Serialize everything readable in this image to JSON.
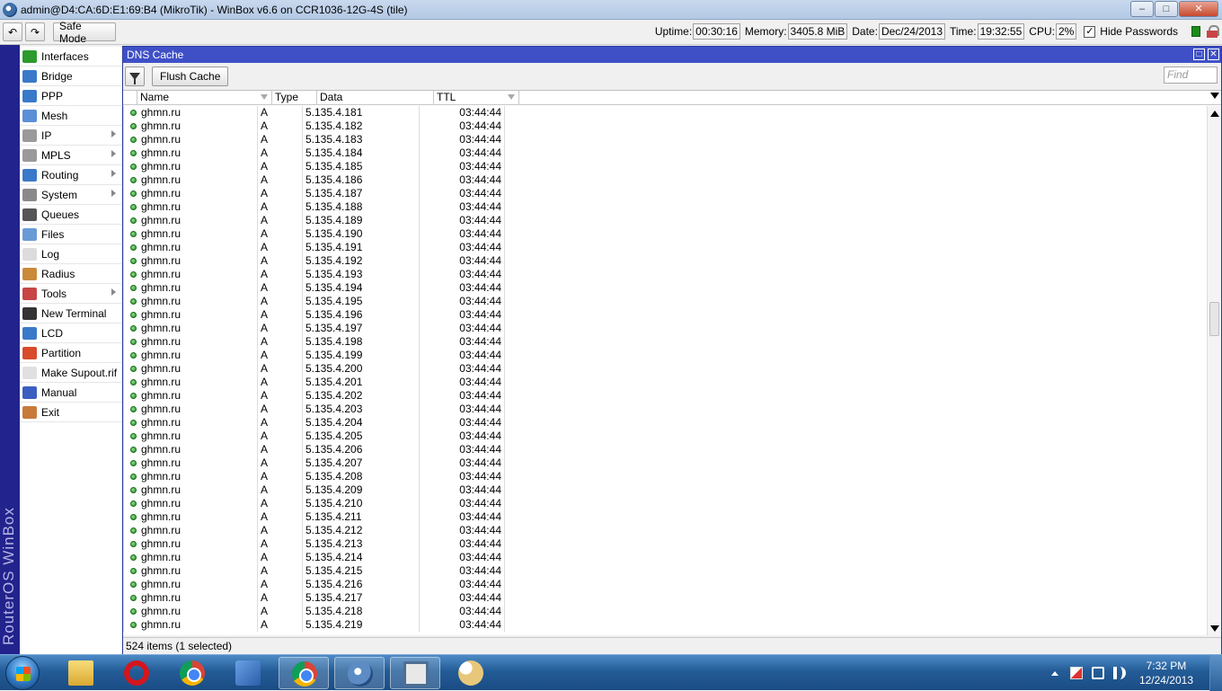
{
  "titlebar": {
    "title": "admin@D4:CA:6D:E1:69:B4 (MikroTik) - WinBox v6.6 on CCR1036-12G-4S (tile)"
  },
  "toolbar": {
    "undo_icon": "undo-icon",
    "redo_icon": "redo-icon",
    "safe_mode": "Safe Mode",
    "uptime_label": "Uptime:",
    "uptime": "00:30:16",
    "memory_label": "Memory:",
    "memory": "3405.8 MiB",
    "date_label": "Date:",
    "date": "Dec/24/2013",
    "time_label": "Time:",
    "time": "19:32:55",
    "cpu_label": "CPU:",
    "cpu": "2%",
    "hide_passwords": "Hide Passwords",
    "hide_passwords_checked": true
  },
  "brand": "RouterOS WinBox",
  "sidebar": {
    "items": [
      {
        "label": "Interfaces",
        "icon": "interfaces-icon",
        "color": "#2d9b2d",
        "submenu": false
      },
      {
        "label": "Bridge",
        "icon": "bridge-icon",
        "color": "#3a79c9",
        "submenu": false
      },
      {
        "label": "PPP",
        "icon": "ppp-icon",
        "color": "#3a79c9",
        "submenu": false
      },
      {
        "label": "Mesh",
        "icon": "mesh-icon",
        "color": "#5b8fd6",
        "submenu": false
      },
      {
        "label": "IP",
        "icon": "ip-icon",
        "color": "#9a9a9a",
        "submenu": true
      },
      {
        "label": "MPLS",
        "icon": "mpls-icon",
        "color": "#9a9a9a",
        "submenu": true
      },
      {
        "label": "Routing",
        "icon": "routing-icon",
        "color": "#3a79c9",
        "submenu": true
      },
      {
        "label": "System",
        "icon": "system-icon",
        "color": "#8a8a8a",
        "submenu": true
      },
      {
        "label": "Queues",
        "icon": "queues-icon",
        "color": "#555555",
        "submenu": false
      },
      {
        "label": "Files",
        "icon": "files-icon",
        "color": "#6a9bd6",
        "submenu": false
      },
      {
        "label": "Log",
        "icon": "log-icon",
        "color": "#dcdcdc",
        "submenu": false
      },
      {
        "label": "Radius",
        "icon": "radius-icon",
        "color": "#c98a3a",
        "submenu": false
      },
      {
        "label": "Tools",
        "icon": "tools-icon",
        "color": "#c84545",
        "submenu": true
      },
      {
        "label": "New Terminal",
        "icon": "terminal-icon",
        "color": "#333333",
        "submenu": false
      },
      {
        "label": "LCD",
        "icon": "lcd-icon",
        "color": "#3a79c9",
        "submenu": false
      },
      {
        "label": "Partition",
        "icon": "partition-icon",
        "color": "#d84b2a",
        "submenu": false
      },
      {
        "label": "Make Supout.rif",
        "icon": "supout-icon",
        "color": "#e0e0e0",
        "submenu": false
      },
      {
        "label": "Manual",
        "icon": "manual-icon",
        "color": "#3a5fc0",
        "submenu": false
      },
      {
        "label": "Exit",
        "icon": "exit-icon",
        "color": "#c87a3a",
        "submenu": false
      }
    ]
  },
  "dns": {
    "title": "DNS Cache",
    "flush_cache": "Flush Cache",
    "find_placeholder": "Find",
    "columns": {
      "name": "Name",
      "type": "Type",
      "data": "Data",
      "ttl": "TTL"
    },
    "rows": [
      {
        "name": "ghmn.ru",
        "type": "A",
        "data": "5.135.4.181",
        "ttl": "03:44:44"
      },
      {
        "name": "ghmn.ru",
        "type": "A",
        "data": "5.135.4.182",
        "ttl": "03:44:44"
      },
      {
        "name": "ghmn.ru",
        "type": "A",
        "data": "5.135.4.183",
        "ttl": "03:44:44"
      },
      {
        "name": "ghmn.ru",
        "type": "A",
        "data": "5.135.4.184",
        "ttl": "03:44:44"
      },
      {
        "name": "ghmn.ru",
        "type": "A",
        "data": "5.135.4.185",
        "ttl": "03:44:44"
      },
      {
        "name": "ghmn.ru",
        "type": "A",
        "data": "5.135.4.186",
        "ttl": "03:44:44"
      },
      {
        "name": "ghmn.ru",
        "type": "A",
        "data": "5.135.4.187",
        "ttl": "03:44:44"
      },
      {
        "name": "ghmn.ru",
        "type": "A",
        "data": "5.135.4.188",
        "ttl": "03:44:44"
      },
      {
        "name": "ghmn.ru",
        "type": "A",
        "data": "5.135.4.189",
        "ttl": "03:44:44"
      },
      {
        "name": "ghmn.ru",
        "type": "A",
        "data": "5.135.4.190",
        "ttl": "03:44:44"
      },
      {
        "name": "ghmn.ru",
        "type": "A",
        "data": "5.135.4.191",
        "ttl": "03:44:44"
      },
      {
        "name": "ghmn.ru",
        "type": "A",
        "data": "5.135.4.192",
        "ttl": "03:44:44"
      },
      {
        "name": "ghmn.ru",
        "type": "A",
        "data": "5.135.4.193",
        "ttl": "03:44:44"
      },
      {
        "name": "ghmn.ru",
        "type": "A",
        "data": "5.135.4.194",
        "ttl": "03:44:44"
      },
      {
        "name": "ghmn.ru",
        "type": "A",
        "data": "5.135.4.195",
        "ttl": "03:44:44"
      },
      {
        "name": "ghmn.ru",
        "type": "A",
        "data": "5.135.4.196",
        "ttl": "03:44:44"
      },
      {
        "name": "ghmn.ru",
        "type": "A",
        "data": "5.135.4.197",
        "ttl": "03:44:44"
      },
      {
        "name": "ghmn.ru",
        "type": "A",
        "data": "5.135.4.198",
        "ttl": "03:44:44"
      },
      {
        "name": "ghmn.ru",
        "type": "A",
        "data": "5.135.4.199",
        "ttl": "03:44:44"
      },
      {
        "name": "ghmn.ru",
        "type": "A",
        "data": "5.135.4.200",
        "ttl": "03:44:44"
      },
      {
        "name": "ghmn.ru",
        "type": "A",
        "data": "5.135.4.201",
        "ttl": "03:44:44"
      },
      {
        "name": "ghmn.ru",
        "type": "A",
        "data": "5.135.4.202",
        "ttl": "03:44:44"
      },
      {
        "name": "ghmn.ru",
        "type": "A",
        "data": "5.135.4.203",
        "ttl": "03:44:44"
      },
      {
        "name": "ghmn.ru",
        "type": "A",
        "data": "5.135.4.204",
        "ttl": "03:44:44"
      },
      {
        "name": "ghmn.ru",
        "type": "A",
        "data": "5.135.4.205",
        "ttl": "03:44:44"
      },
      {
        "name": "ghmn.ru",
        "type": "A",
        "data": "5.135.4.206",
        "ttl": "03:44:44"
      },
      {
        "name": "ghmn.ru",
        "type": "A",
        "data": "5.135.4.207",
        "ttl": "03:44:44"
      },
      {
        "name": "ghmn.ru",
        "type": "A",
        "data": "5.135.4.208",
        "ttl": "03:44:44"
      },
      {
        "name": "ghmn.ru",
        "type": "A",
        "data": "5.135.4.209",
        "ttl": "03:44:44"
      },
      {
        "name": "ghmn.ru",
        "type": "A",
        "data": "5.135.4.210",
        "ttl": "03:44:44"
      },
      {
        "name": "ghmn.ru",
        "type": "A",
        "data": "5.135.4.211",
        "ttl": "03:44:44"
      },
      {
        "name": "ghmn.ru",
        "type": "A",
        "data": "5.135.4.212",
        "ttl": "03:44:44"
      },
      {
        "name": "ghmn.ru",
        "type": "A",
        "data": "5.135.4.213",
        "ttl": "03:44:44"
      },
      {
        "name": "ghmn.ru",
        "type": "A",
        "data": "5.135.4.214",
        "ttl": "03:44:44"
      },
      {
        "name": "ghmn.ru",
        "type": "A",
        "data": "5.135.4.215",
        "ttl": "03:44:44"
      },
      {
        "name": "ghmn.ru",
        "type": "A",
        "data": "5.135.4.216",
        "ttl": "03:44:44"
      },
      {
        "name": "ghmn.ru",
        "type": "A",
        "data": "5.135.4.217",
        "ttl": "03:44:44"
      },
      {
        "name": "ghmn.ru",
        "type": "A",
        "data": "5.135.4.218",
        "ttl": "03:44:44"
      },
      {
        "name": "ghmn.ru",
        "type": "A",
        "data": "5.135.4.219",
        "ttl": "03:44:44"
      }
    ],
    "status": "524 items (1 selected)"
  },
  "taskbar": {
    "apps": [
      {
        "icon": "file-explorer-icon",
        "cls": "ic-folder",
        "active": false
      },
      {
        "icon": "opera-icon",
        "cls": "ic-opera",
        "active": false
      },
      {
        "icon": "chrome-icon",
        "cls": "ic-chrome",
        "active": false
      },
      {
        "icon": "network-tool-icon",
        "cls": "ic-net",
        "active": false
      },
      {
        "icon": "chrome-icon",
        "cls": "ic-chrome",
        "active": true
      },
      {
        "icon": "winbox-icon",
        "cls": "ic-winbox",
        "active": true
      },
      {
        "icon": "monitor-icon",
        "cls": "ic-monitor",
        "active": true
      },
      {
        "icon": "paint-icon",
        "cls": "ic-paint",
        "active": false
      }
    ],
    "clock_time": "7:32 PM",
    "clock_date": "12/24/2013"
  }
}
